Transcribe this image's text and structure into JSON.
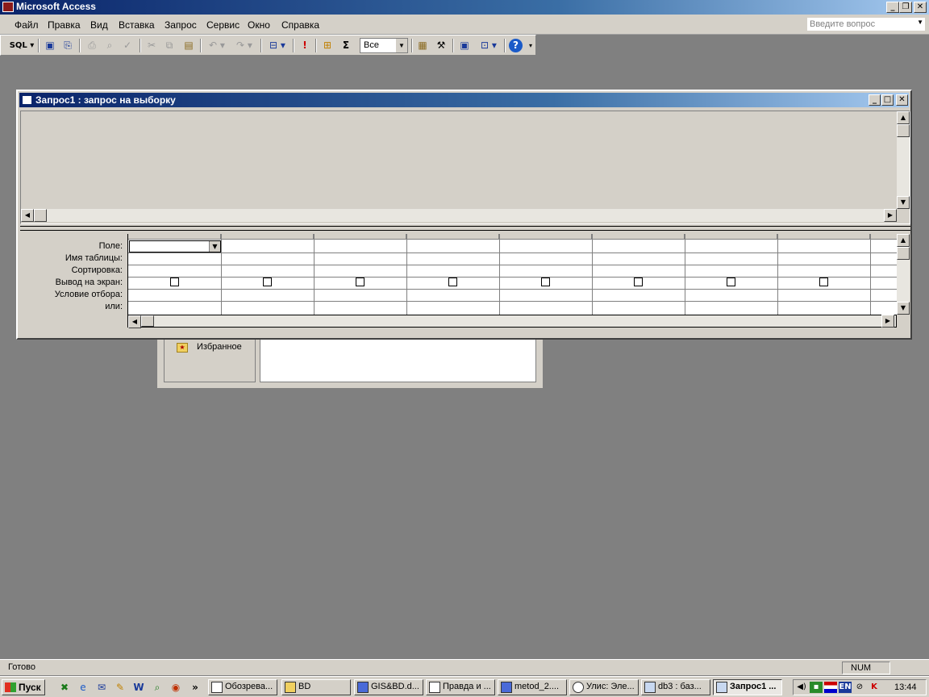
{
  "app": {
    "title": "Microsoft Access",
    "ask_placeholder": "Введите вопрос"
  },
  "menu": [
    "Файл",
    "Правка",
    "Вид",
    "Вставка",
    "Запрос",
    "Сервис",
    "Окно",
    "Справка"
  ],
  "toolbar": {
    "view_label": "SQL",
    "top_values": "Все",
    "sigma": "Σ",
    "exclamation": "!"
  },
  "query_window": {
    "title": "Запрос1 : запрос на выборку"
  },
  "qbe_rows": [
    "Поле:",
    "Имя таблицы:",
    "Сортировка:",
    "Вывод на экран:",
    "Условие отбора:",
    "или:"
  ],
  "db_window": {
    "favorites_label": "Избранное"
  },
  "status": {
    "text": "Готово",
    "num": "NUM"
  },
  "taskbar": {
    "start_label": "Пуск",
    "more": "»",
    "buttons": [
      {
        "label": "Обозрева..."
      },
      {
        "label": "BD"
      },
      {
        "label": "GIS&BD.d..."
      },
      {
        "label": "Правда и ..."
      },
      {
        "label": "metod_2...."
      },
      {
        "label": "Улис: Эле..."
      },
      {
        "label": "db3 : баз..."
      },
      {
        "label": "Запрос1 ..."
      }
    ],
    "lang": "EN",
    "clock": "13:44"
  }
}
